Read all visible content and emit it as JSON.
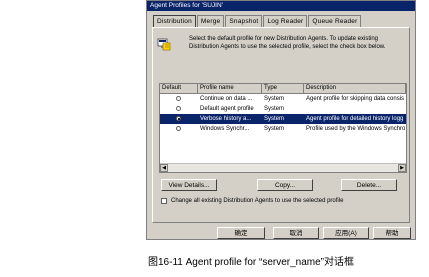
{
  "dialog": {
    "title": "Agent Profiles for 'SUJIN'",
    "tabs": [
      "Distribution",
      "Merge",
      "Snapshot",
      "Log Reader",
      "Queue Reader"
    ],
    "active_tab": 0,
    "description": "Select the default profile for new Distribution Agents. To update existing Distribution Agents to use the selected profile, select the check box below.",
    "table": {
      "headers": [
        "Default",
        "Profile name",
        "Type",
        "Description"
      ],
      "rows": [
        {
          "default": false,
          "name": "Continue on data ...",
          "type": "System",
          "description": "Agent profile for skipping data consis",
          "selected": false
        },
        {
          "default": false,
          "name": "Default agent profile",
          "type": "System",
          "description": "",
          "selected": false
        },
        {
          "default": true,
          "name": "Verbose history a...",
          "type": "System",
          "description": "Agent profile for detailed history logg",
          "selected": true
        },
        {
          "default": false,
          "name": "Windows Synchr...",
          "type": "System",
          "description": "Profile used by the Windows Synchro",
          "selected": false
        }
      ]
    },
    "buttons": {
      "view_details": "View Details...",
      "copy": "Copy...",
      "delete": "Delete..."
    },
    "checkbox_label": "Change all existing Distribution Agents to use the selected profile",
    "footer": {
      "ok": "确定",
      "cancel": "取消",
      "apply": "应用(A)",
      "help": "帮助"
    }
  },
  "caption": "图16-11  Agent profile for “server_name”对话框"
}
